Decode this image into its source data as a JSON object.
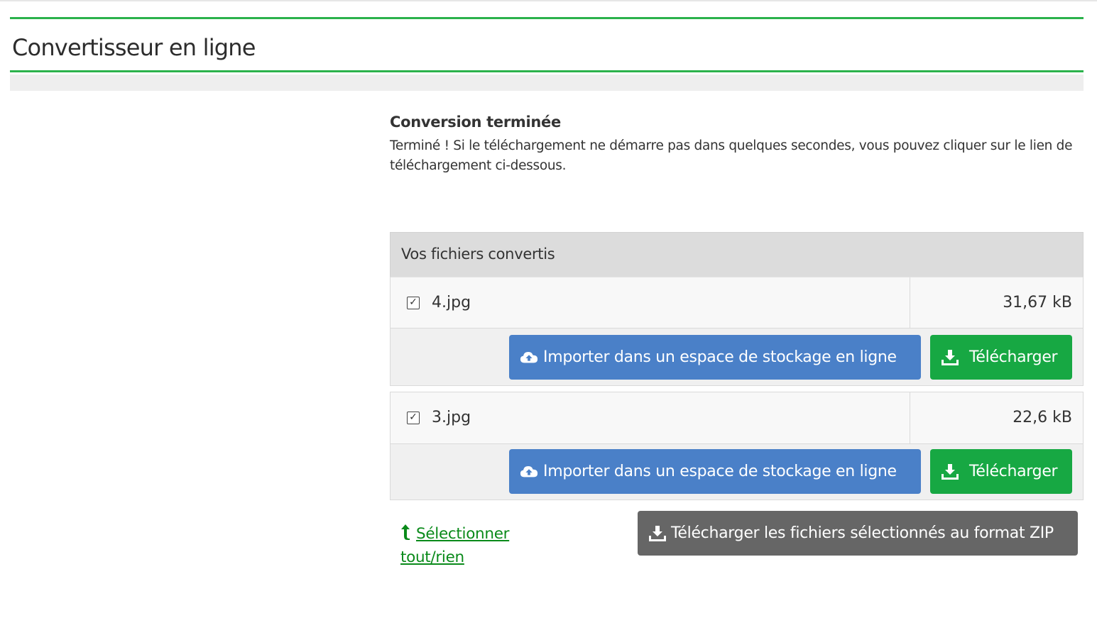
{
  "header": {
    "title": "Convertisseur en ligne"
  },
  "status": {
    "heading": "Conversion terminée",
    "message": "Terminé ! Si le téléchargement ne démarre pas dans quelques secondes, vous pouvez cliquer sur le lien de téléchargement ci-dessous."
  },
  "files_panel": {
    "title": "Vos fichiers convertis",
    "files": [
      {
        "name": "4.jpg",
        "size": "31,67 kB",
        "checked": true,
        "upload_label": "Importer dans un espace de stockage en ligne",
        "download_label": "Télécharger"
      },
      {
        "name": "3.jpg",
        "size": "22,6 kB",
        "checked": true,
        "upload_label": "Importer dans un espace de stockage en ligne",
        "download_label": "Télécharger"
      }
    ]
  },
  "footer": {
    "select_all_label": "Sélectionner tout/rien",
    "zip_label": "Télécharger les fichiers sélectionnés au format ZIP"
  },
  "icons": {
    "upload": "cloud-upload-icon",
    "download": "download-icon",
    "select": "arrow-up-icon",
    "checkbox": "checkbox-checked-icon"
  },
  "colors": {
    "accent_green": "#2bb24c",
    "upload_blue": "#4a80c8",
    "download_green": "#17a843",
    "zip_grey": "#666666",
    "link_green": "#0a8a1a"
  }
}
